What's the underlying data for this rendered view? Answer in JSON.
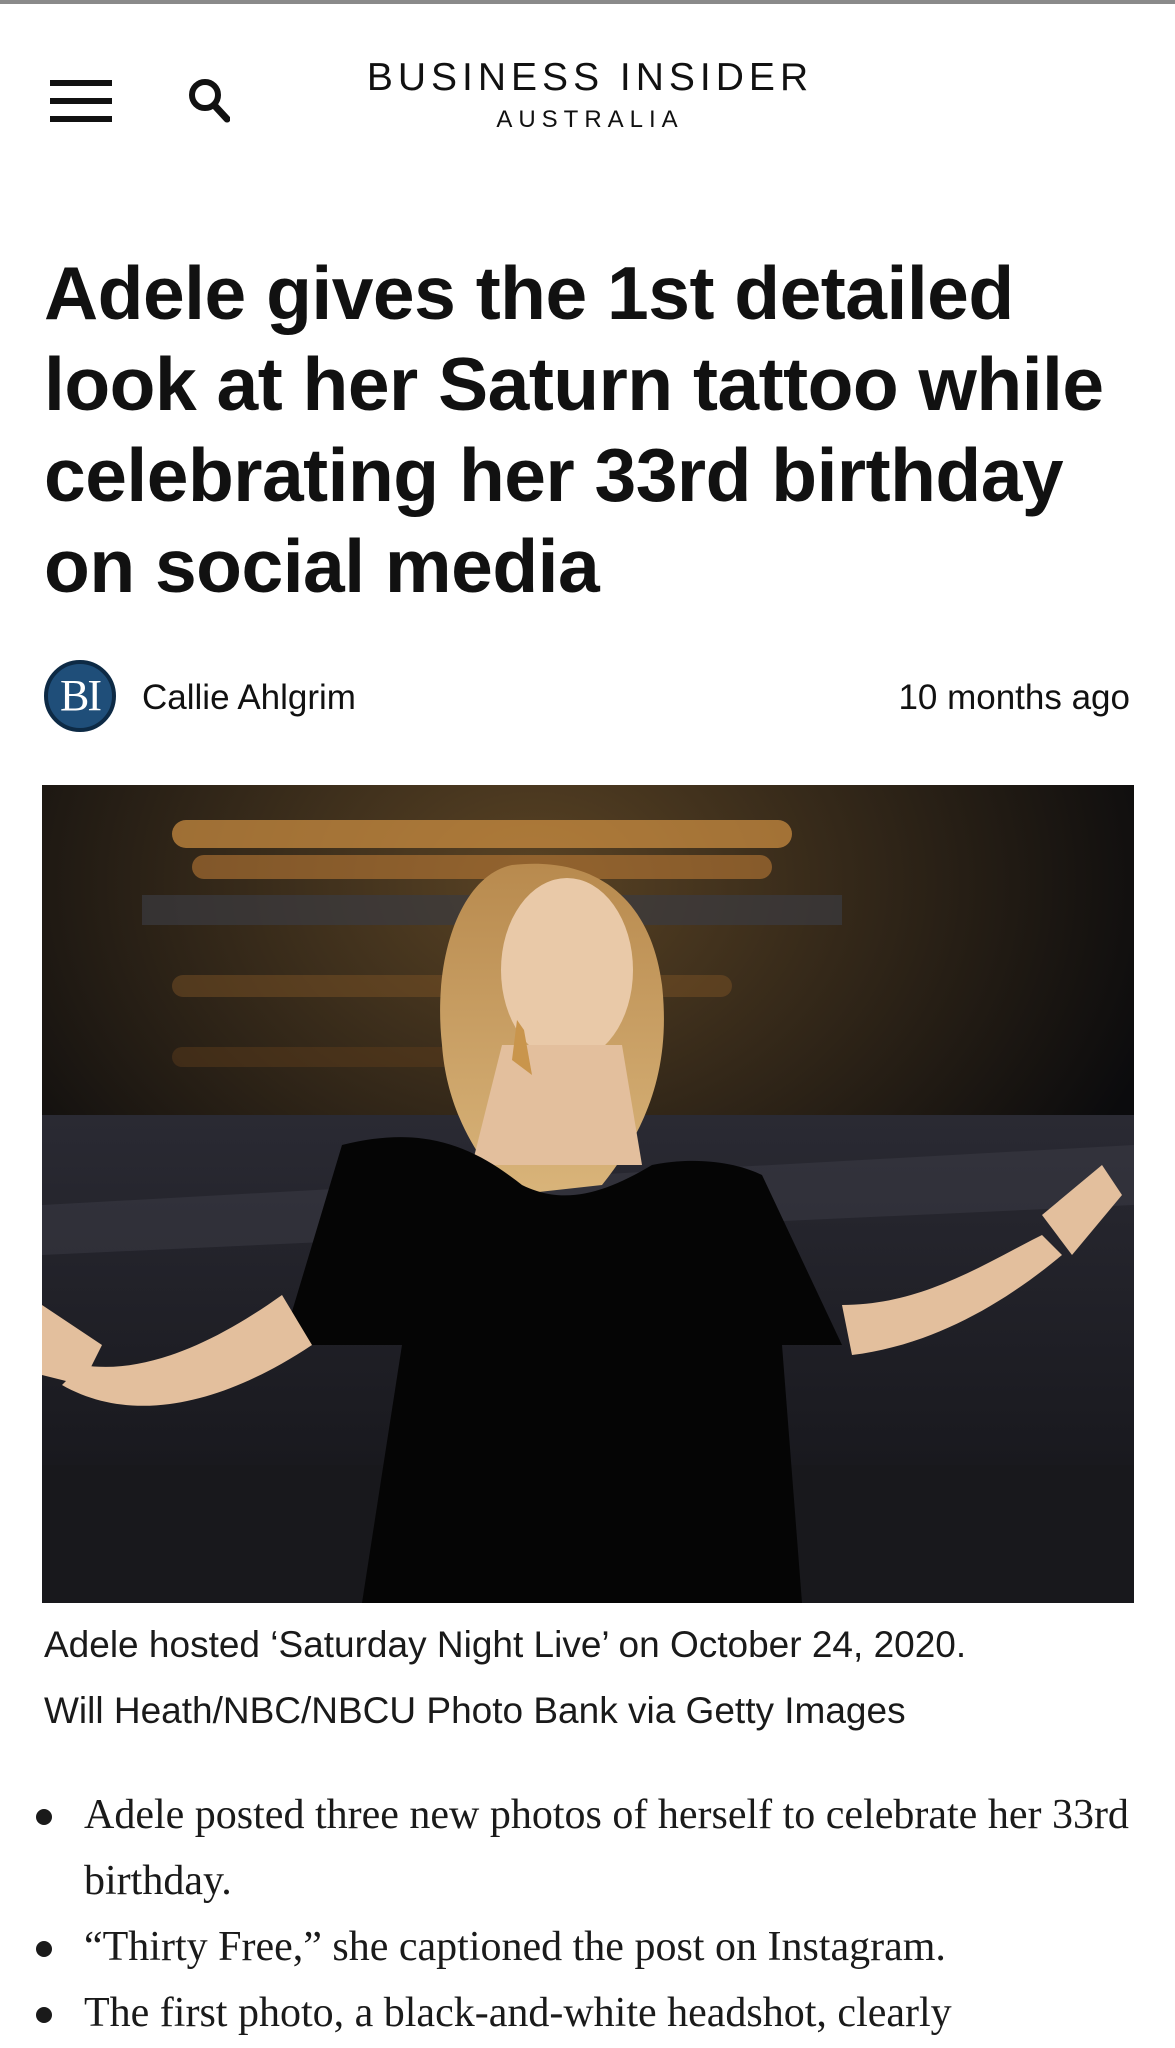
{
  "header": {
    "menu_icon": "hamburger-menu-icon",
    "search_icon": "search-icon",
    "brand_name": "BUSINESS INSIDER",
    "brand_sub": "AUSTRALIA"
  },
  "article": {
    "headline": "Adele gives the 1st detailed look at her Saturn tattoo while celebrating her 33rd birthday on social media",
    "avatar_text": "BI",
    "author": "Callie Ahlgrim",
    "timestamp": "10 months ago",
    "caption_line1": "Adele hosted ‘Saturday Night Live’ on October 24, 2020.",
    "caption_line2": "Will Heath/NBC/NBCU Photo Bank via Getty Images",
    "bullets": [
      "Adele posted three new photos of herself to celebrate her 33rd birthday.",
      "“Thirty Free,” she captioned the post on Instagram.",
      "The first photo, a black-and-white headshot, clearly"
    ]
  },
  "colors": {
    "text": "#111111",
    "avatar_bg": "#1f4e79",
    "photo_bg": "#0b0b0d"
  }
}
